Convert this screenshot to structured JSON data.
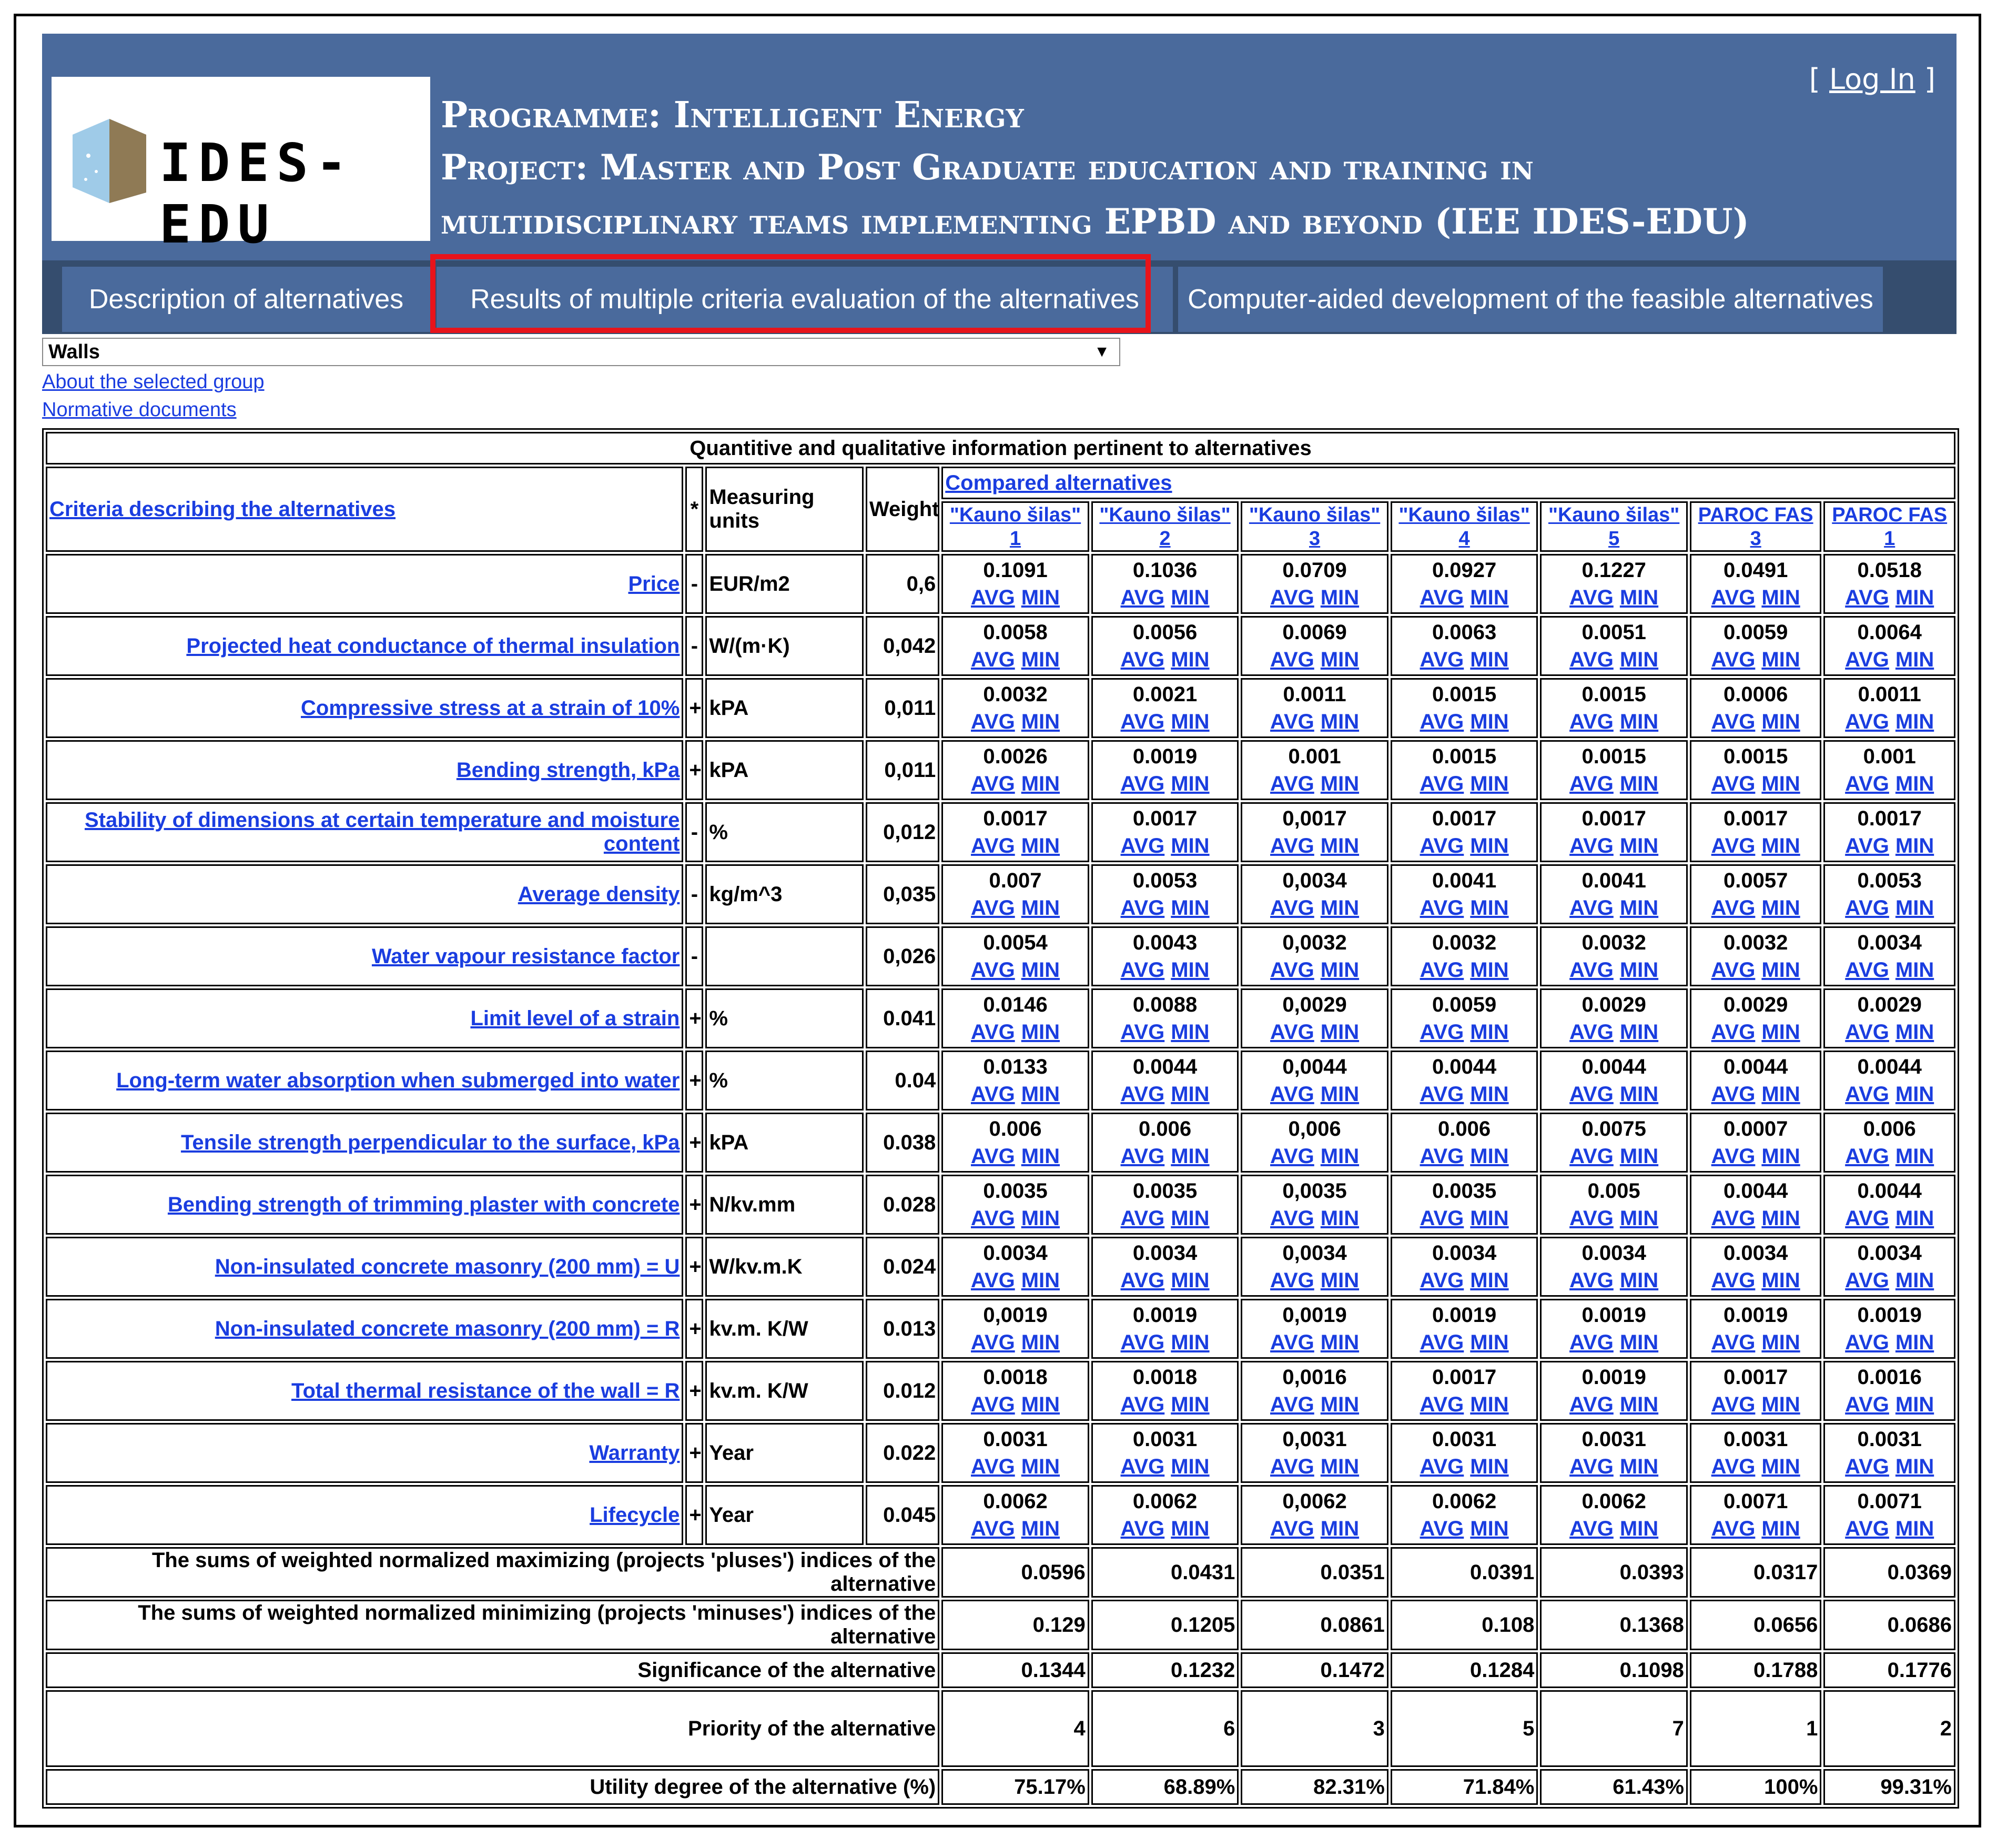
{
  "header": {
    "logo_text": "IDES-EDU",
    "programme": "Programme: Intelligent Energy",
    "project_line1": "Project: Master and Post Graduate education and training in",
    "project_line2": "multidisciplinary teams implementing EPBD and beyond (IEE IDES-EDU)",
    "login_prefix": "[ ",
    "login_label": "Log In",
    "login_suffix": " ]"
  },
  "tabs": [
    {
      "label": "Description of alternatives"
    },
    {
      "label": "Results of multiple criteria evaluation of the alternatives"
    },
    {
      "label": "Computer-aided development of the feasible alternatives"
    }
  ],
  "highlight_color": "#e8141b",
  "group_select": {
    "value": "Walls"
  },
  "links": {
    "about": "About the selected group",
    "normative": "Normative documents"
  },
  "table": {
    "title": "Quantitive and qualitative information pertinent to alternatives",
    "col_criteria": "Criteria describing the alternatives",
    "col_star": "*",
    "col_units": "Measuring units",
    "col_weight": "Weight",
    "col_compared": "Compared alternatives",
    "alternatives": [
      "\"Kauno šilas\" 1",
      "\"Kauno šilas\" 2",
      "\"Kauno šilas\" 3",
      "\"Kauno šilas\" 4",
      "\"Kauno šilas\" 5",
      "PAROC FAS 3",
      "PAROC FAS 1"
    ],
    "avg_label": "AVG",
    "min_label": "MIN",
    "rows": [
      {
        "name": "Price",
        "sign": "-",
        "unit": "EUR/m2",
        "weight": "0,6",
        "values": [
          "0.1091",
          "0.1036",
          "0.0709",
          "0.0927",
          "0.1227",
          "0.0491",
          "0.0518"
        ]
      },
      {
        "name": "Projected heat conductance of thermal insulation",
        "sign": "-",
        "unit": "W/(m·K)",
        "weight": "0,042",
        "values": [
          "0.0058",
          "0.0056",
          "0.0069",
          "0.0063",
          "0.0051",
          "0.0059",
          "0.0064"
        ]
      },
      {
        "name": "Compressive stress at a strain of 10%",
        "sign": "+",
        "unit": "kPA",
        "weight": "0,011",
        "values": [
          "0.0032",
          "0.0021",
          "0.0011",
          "0.0015",
          "0.0015",
          "0.0006",
          "0.0011"
        ]
      },
      {
        "name": "Bending strength, kPa",
        "sign": "+",
        "unit": "kPA",
        "weight": "0,011",
        "values": [
          "0.0026",
          "0.0019",
          "0.001",
          "0.0015",
          "0.0015",
          "0.0015",
          "0.001"
        ]
      },
      {
        "name": "Stability of dimensions at certain temperature and moisture content",
        "sign": "-",
        "unit": "%",
        "weight": "0,012",
        "values": [
          "0.0017",
          "0.0017",
          "0,0017",
          "0.0017",
          "0.0017",
          "0.0017",
          "0.0017"
        ]
      },
      {
        "name": "Average density",
        "sign": "-",
        "unit": "kg/m^3",
        "weight": "0,035",
        "values": [
          "0.007",
          "0.0053",
          "0,0034",
          "0.0041",
          "0.0041",
          "0.0057",
          "0.0053"
        ]
      },
      {
        "name": "Water vapour resistance factor",
        "sign": "-",
        "unit": "",
        "weight": "0,026",
        "values": [
          "0.0054",
          "0.0043",
          "0,0032",
          "0.0032",
          "0.0032",
          "0.0032",
          "0.0034"
        ]
      },
      {
        "name": "Limit level of a strain",
        "sign": "+",
        "unit": "%",
        "weight": "0.041",
        "values": [
          "0.0146",
          "0.0088",
          "0,0029",
          "0.0059",
          "0.0029",
          "0.0029",
          "0.0029"
        ]
      },
      {
        "name": "Long-term water absorption when submerged into water",
        "sign": "+",
        "unit": "%",
        "weight": "0.04",
        "values": [
          "0.0133",
          "0.0044",
          "0,0044",
          "0.0044",
          "0.0044",
          "0.0044",
          "0.0044"
        ]
      },
      {
        "name": "Tensile strength perpendicular to the surface, kPa",
        "sign": "+",
        "unit": "kPA",
        "weight": "0.038",
        "values": [
          "0.006",
          "0.006",
          "0,006",
          "0.006",
          "0.0075",
          "0.0007",
          "0.006"
        ]
      },
      {
        "name": "Bending strength of trimming plaster with concrete",
        "sign": "+",
        "unit": "N/kv.mm",
        "weight": "0.028",
        "values": [
          "0.0035",
          "0.0035",
          "0,0035",
          "0.0035",
          "0.005",
          "0.0044",
          "0.0044"
        ]
      },
      {
        "name": "Non-insulated concrete masonry (200 mm) = U",
        "sign": "+",
        "unit": "W/kv.m.K",
        "weight": "0.024",
        "values": [
          "0.0034",
          "0.0034",
          "0,0034",
          "0.0034",
          "0.0034",
          "0.0034",
          "0.0034"
        ]
      },
      {
        "name": "Non-insulated concrete masonry (200 mm) = R",
        "sign": "+",
        "unit": "kv.m. K/W",
        "weight": "0.013",
        "values": [
          "0,0019",
          "0.0019",
          "0,0019",
          "0.0019",
          "0.0019",
          "0.0019",
          "0.0019"
        ]
      },
      {
        "name": "Total thermal resistance of the wall = R",
        "sign": "+",
        "unit": "kv.m. K/W",
        "weight": "0.012",
        "values": [
          "0.0018",
          "0.0018",
          "0,0016",
          "0.0017",
          "0.0019",
          "0.0017",
          "0.0016"
        ]
      },
      {
        "name": "Warranty",
        "sign": "+",
        "unit": "Year",
        "weight": "0.022",
        "values": [
          "0.0031",
          "0.0031",
          "0,0031",
          "0.0031",
          "0.0031",
          "0.0031",
          "0.0031"
        ]
      },
      {
        "name": "Lifecycle",
        "sign": "+",
        "unit": "Year",
        "weight": "0.045",
        "values": [
          "0.0062",
          "0.0062",
          "0,0062",
          "0.0062",
          "0.0062",
          "0.0071",
          "0.0071"
        ]
      }
    ],
    "summary": [
      {
        "label": "The sums of weighted normalized maximizing (projects 'pluses') indices of the alternative",
        "values": [
          "0.0596",
          "0.0431",
          "0.0351",
          "0.0391",
          "0.0393",
          "0.0317",
          "0.0369"
        ]
      },
      {
        "label": "The sums of weighted normalized minimizing (projects 'minuses') indices of the alternative",
        "values": [
          "0.129",
          "0.1205",
          "0.0861",
          "0.108",
          "0.1368",
          "0.0656",
          "0.0686"
        ]
      },
      {
        "label": "Significance of the alternative",
        "values": [
          "0.1344",
          "0.1232",
          "0.1472",
          "0.1284",
          "0.1098",
          "0.1788",
          "0.1776"
        ]
      },
      {
        "label": "Priority of the alternative",
        "values": [
          "4",
          "6",
          "3",
          "5",
          "7",
          "1",
          "2"
        ]
      },
      {
        "label": "Utility degree of the alternative (%)",
        "values": [
          "75.17%",
          "68.89%",
          "82.31%",
          "71.84%",
          "61.43%",
          "100%",
          "99.31%"
        ]
      }
    ]
  }
}
